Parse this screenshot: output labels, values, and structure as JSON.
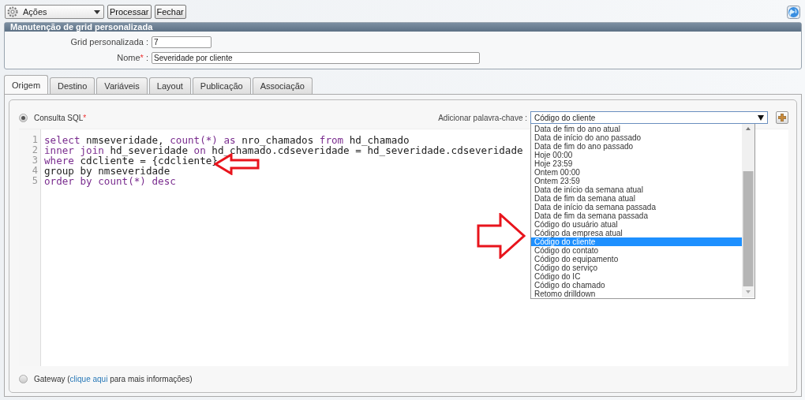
{
  "toolbar": {
    "actions_menu": {
      "label": "Ações"
    },
    "buttons": [
      "Processar",
      "Fechar"
    ]
  },
  "panel": {
    "title": "Manutenção de grid personalizada",
    "fields": [
      {
        "label": "Grid personalizada",
        "colon": ":",
        "value": "7",
        "kind": "short"
      },
      {
        "label": "Nome",
        "required_mark": "*",
        "colon": ":",
        "value": "Severidade por cliente",
        "kind": "long"
      }
    ]
  },
  "tabs": [
    {
      "label": "Origem",
      "selected": true
    },
    {
      "label": "Destino",
      "selected": false
    },
    {
      "label": "Variáveis",
      "selected": false
    },
    {
      "label": "Layout",
      "selected": false
    },
    {
      "label": "Publicação",
      "selected": false
    },
    {
      "label": "Associação",
      "selected": false
    }
  ],
  "sql_option": {
    "label": "Consulta SQL",
    "required_mark": "*",
    "selected": true
  },
  "keyword": {
    "label": "Adicionar palavra-chave",
    "colon": ":",
    "value": "Código do cliente",
    "expanded": true,
    "options": [
      {
        "label": "Data de fim do ano atual",
        "selected": false
      },
      {
        "label": "Data de início do ano passado",
        "selected": false
      },
      {
        "label": "Data de fim do ano passado",
        "selected": false
      },
      {
        "label": "Hoje 00:00",
        "selected": false
      },
      {
        "label": "Hoje 23:59",
        "selected": false
      },
      {
        "label": "Ontem 00:00",
        "selected": false
      },
      {
        "label": "Ontem 23:59",
        "selected": false
      },
      {
        "label": "Data de início da semana atual",
        "selected": false
      },
      {
        "label": "Data de fim da semana atual",
        "selected": false
      },
      {
        "label": "Data de início da semana passada",
        "selected": false
      },
      {
        "label": "Data de fim da semana passada",
        "selected": false
      },
      {
        "label": "Código do usuário atual",
        "selected": false
      },
      {
        "label": "Código da empresa atual",
        "selected": false
      },
      {
        "label": "Código do cliente",
        "selected": true
      },
      {
        "label": "Código do contato",
        "selected": false
      },
      {
        "label": "Código do equipamento",
        "selected": false
      },
      {
        "label": "Código do serviço",
        "selected": false
      },
      {
        "label": "Código do IC",
        "selected": false
      },
      {
        "label": "Código do chamado",
        "selected": false
      },
      {
        "label": "Retomo drilldown",
        "selected": false
      }
    ]
  },
  "code_lines": [
    {
      "number": "1",
      "tokens": [
        {
          "text": "select",
          "kind": "keyword"
        },
        {
          "text": " nmseveridade, ",
          "kind": "plain"
        },
        {
          "text": "count(*) as",
          "kind": "keyword"
        },
        {
          "text": " nro_chamados ",
          "kind": "plain"
        },
        {
          "text": "from",
          "kind": "keyword"
        },
        {
          "text": " hd_chamado",
          "kind": "plain"
        }
      ]
    },
    {
      "number": "2",
      "tokens": [
        {
          "text": "inner join",
          "kind": "keyword"
        },
        {
          "text": " hd_severidade ",
          "kind": "plain"
        },
        {
          "text": "on",
          "kind": "keyword"
        },
        {
          "text": " hd_chamado.cdseveridade = hd_severidade.cdseveridade",
          "kind": "plain"
        }
      ]
    },
    {
      "number": "3",
      "tokens": [
        {
          "text": "where",
          "kind": "keyword"
        },
        {
          "text": " cdcliente = {cdcliente}",
          "kind": "plain"
        }
      ]
    },
    {
      "number": "4",
      "tokens": [
        {
          "text": "group by nmseveridade",
          "kind": "plain"
        }
      ]
    },
    {
      "number": "5",
      "tokens": [
        {
          "text": "order by count(*) desc",
          "kind": "keyword"
        }
      ]
    }
  ],
  "gateway_option": {
    "label_before": "Gateway (",
    "link": "clique aqui",
    "label_after": " para mais informações)",
    "selected": false
  }
}
